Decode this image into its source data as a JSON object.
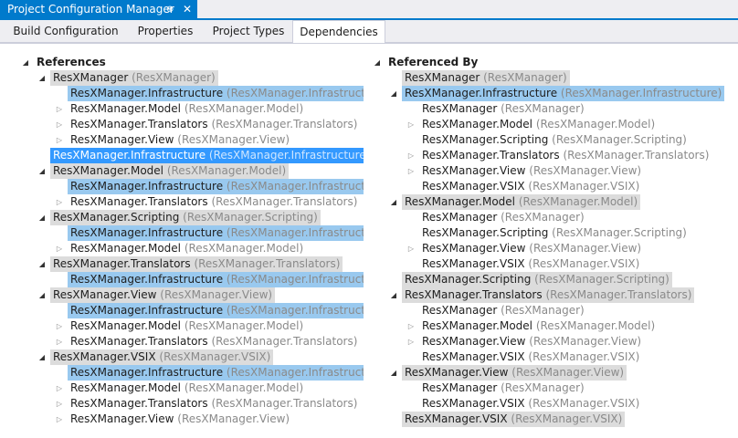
{
  "window": {
    "title": "Project Configuration Manager",
    "pin_glyph": "⊕",
    "close_glyph": "✕"
  },
  "tabs": [
    {
      "label": "Build Configuration",
      "active": false
    },
    {
      "label": "Properties",
      "active": false
    },
    {
      "label": "Project Types",
      "active": false
    },
    {
      "label": "Dependencies",
      "active": true
    }
  ],
  "references": {
    "header": "References",
    "rows": [
      {
        "level": 1,
        "exp": "open",
        "text": "ResXManager",
        "sub": "(ResXManager)",
        "hl": "gray"
      },
      {
        "level": 2,
        "exp": "none",
        "text": "ResXManager.Infrastructure",
        "sub": "(ResXManager.Infrastructure)",
        "hl": "blue"
      },
      {
        "level": 2,
        "exp": "closed",
        "text": "ResXManager.Model",
        "sub": "(ResXManager.Model)",
        "hl": ""
      },
      {
        "level": 2,
        "exp": "closed",
        "text": "ResXManager.Translators",
        "sub": "(ResXManager.Translators)",
        "hl": ""
      },
      {
        "level": 2,
        "exp": "closed",
        "text": "ResXManager.View",
        "sub": "(ResXManager.View)",
        "hl": ""
      },
      {
        "level": 1,
        "exp": "none",
        "text": "ResXManager.Infrastructure",
        "sub": "(ResXManager.Infrastructure)",
        "hl": "sel"
      },
      {
        "level": 1,
        "exp": "open",
        "text": "ResXManager.Model",
        "sub": "(ResXManager.Model)",
        "hl": "gray"
      },
      {
        "level": 2,
        "exp": "none",
        "text": "ResXManager.Infrastructure",
        "sub": "(ResXManager.Infrastructure)",
        "hl": "blue"
      },
      {
        "level": 2,
        "exp": "closed",
        "text": "ResXManager.Translators",
        "sub": "(ResXManager.Translators)",
        "hl": ""
      },
      {
        "level": 1,
        "exp": "open",
        "text": "ResXManager.Scripting",
        "sub": "(ResXManager.Scripting)",
        "hl": "gray"
      },
      {
        "level": 2,
        "exp": "none",
        "text": "ResXManager.Infrastructure",
        "sub": "(ResXManager.Infrastructure)",
        "hl": "blue"
      },
      {
        "level": 2,
        "exp": "closed",
        "text": "ResXManager.Model",
        "sub": "(ResXManager.Model)",
        "hl": ""
      },
      {
        "level": 1,
        "exp": "open",
        "text": "ResXManager.Translators",
        "sub": "(ResXManager.Translators)",
        "hl": "gray"
      },
      {
        "level": 2,
        "exp": "none",
        "text": "ResXManager.Infrastructure",
        "sub": "(ResXManager.Infrastructure)",
        "hl": "blue"
      },
      {
        "level": 1,
        "exp": "open",
        "text": "ResXManager.View",
        "sub": "(ResXManager.View)",
        "hl": "gray"
      },
      {
        "level": 2,
        "exp": "none",
        "text": "ResXManager.Infrastructure",
        "sub": "(ResXManager.Infrastructure)",
        "hl": "blue"
      },
      {
        "level": 2,
        "exp": "closed",
        "text": "ResXManager.Model",
        "sub": "(ResXManager.Model)",
        "hl": ""
      },
      {
        "level": 2,
        "exp": "closed",
        "text": "ResXManager.Translators",
        "sub": "(ResXManager.Translators)",
        "hl": ""
      },
      {
        "level": 1,
        "exp": "open",
        "text": "ResXManager.VSIX",
        "sub": "(ResXManager.VSIX)",
        "hl": "gray"
      },
      {
        "level": 2,
        "exp": "none",
        "text": "ResXManager.Infrastructure",
        "sub": "(ResXManager.Infrastructure)",
        "hl": "blue"
      },
      {
        "level": 2,
        "exp": "closed",
        "text": "ResXManager.Model",
        "sub": "(ResXManager.Model)",
        "hl": ""
      },
      {
        "level": 2,
        "exp": "closed",
        "text": "ResXManager.Translators",
        "sub": "(ResXManager.Translators)",
        "hl": ""
      },
      {
        "level": 2,
        "exp": "closed",
        "text": "ResXManager.View",
        "sub": "(ResXManager.View)",
        "hl": ""
      }
    ]
  },
  "referenced_by": {
    "header": "Referenced By",
    "rows": [
      {
        "level": 1,
        "exp": "none",
        "text": "ResXManager",
        "sub": "(ResXManager)",
        "hl": "gray"
      },
      {
        "level": 1,
        "exp": "open",
        "text": "ResXManager.Infrastructure",
        "sub": "(ResXManager.Infrastructure)",
        "hl": "blue"
      },
      {
        "level": 2,
        "exp": "none",
        "text": "ResXManager",
        "sub": "(ResXManager)",
        "hl": ""
      },
      {
        "level": 2,
        "exp": "closed",
        "text": "ResXManager.Model",
        "sub": "(ResXManager.Model)",
        "hl": ""
      },
      {
        "level": 2,
        "exp": "none",
        "text": "ResXManager.Scripting",
        "sub": "(ResXManager.Scripting)",
        "hl": ""
      },
      {
        "level": 2,
        "exp": "closed",
        "text": "ResXManager.Translators",
        "sub": "(ResXManager.Translators)",
        "hl": ""
      },
      {
        "level": 2,
        "exp": "closed",
        "text": "ResXManager.View",
        "sub": "(ResXManager.View)",
        "hl": ""
      },
      {
        "level": 2,
        "exp": "none",
        "text": "ResXManager.VSIX",
        "sub": "(ResXManager.VSIX)",
        "hl": ""
      },
      {
        "level": 1,
        "exp": "open",
        "text": "ResXManager.Model",
        "sub": "(ResXManager.Model)",
        "hl": "gray"
      },
      {
        "level": 2,
        "exp": "none",
        "text": "ResXManager",
        "sub": "(ResXManager)",
        "hl": ""
      },
      {
        "level": 2,
        "exp": "none",
        "text": "ResXManager.Scripting",
        "sub": "(ResXManager.Scripting)",
        "hl": ""
      },
      {
        "level": 2,
        "exp": "closed",
        "text": "ResXManager.View",
        "sub": "(ResXManager.View)",
        "hl": ""
      },
      {
        "level": 2,
        "exp": "none",
        "text": "ResXManager.VSIX",
        "sub": "(ResXManager.VSIX)",
        "hl": ""
      },
      {
        "level": 1,
        "exp": "none",
        "text": "ResXManager.Scripting",
        "sub": "(ResXManager.Scripting)",
        "hl": "gray"
      },
      {
        "level": 1,
        "exp": "open",
        "text": "ResXManager.Translators",
        "sub": "(ResXManager.Translators)",
        "hl": "gray"
      },
      {
        "level": 2,
        "exp": "none",
        "text": "ResXManager",
        "sub": "(ResXManager)",
        "hl": ""
      },
      {
        "level": 2,
        "exp": "closed",
        "text": "ResXManager.Model",
        "sub": "(ResXManager.Model)",
        "hl": ""
      },
      {
        "level": 2,
        "exp": "closed",
        "text": "ResXManager.View",
        "sub": "(ResXManager.View)",
        "hl": ""
      },
      {
        "level": 2,
        "exp": "none",
        "text": "ResXManager.VSIX",
        "sub": "(ResXManager.VSIX)",
        "hl": ""
      },
      {
        "level": 1,
        "exp": "open",
        "text": "ResXManager.View",
        "sub": "(ResXManager.View)",
        "hl": "gray"
      },
      {
        "level": 2,
        "exp": "none",
        "text": "ResXManager",
        "sub": "(ResXManager)",
        "hl": ""
      },
      {
        "level": 2,
        "exp": "none",
        "text": "ResXManager.VSIX",
        "sub": "(ResXManager.VSIX)",
        "hl": ""
      },
      {
        "level": 1,
        "exp": "none",
        "text": "ResXManager.VSIX",
        "sub": "(ResXManager.VSIX)",
        "hl": "gray"
      }
    ]
  },
  "colors": {
    "accent": "#007acc",
    "selection": "#3399ff",
    "highlight_blue": "#99c9ef",
    "highlight_gray": "#dcdcdc"
  }
}
